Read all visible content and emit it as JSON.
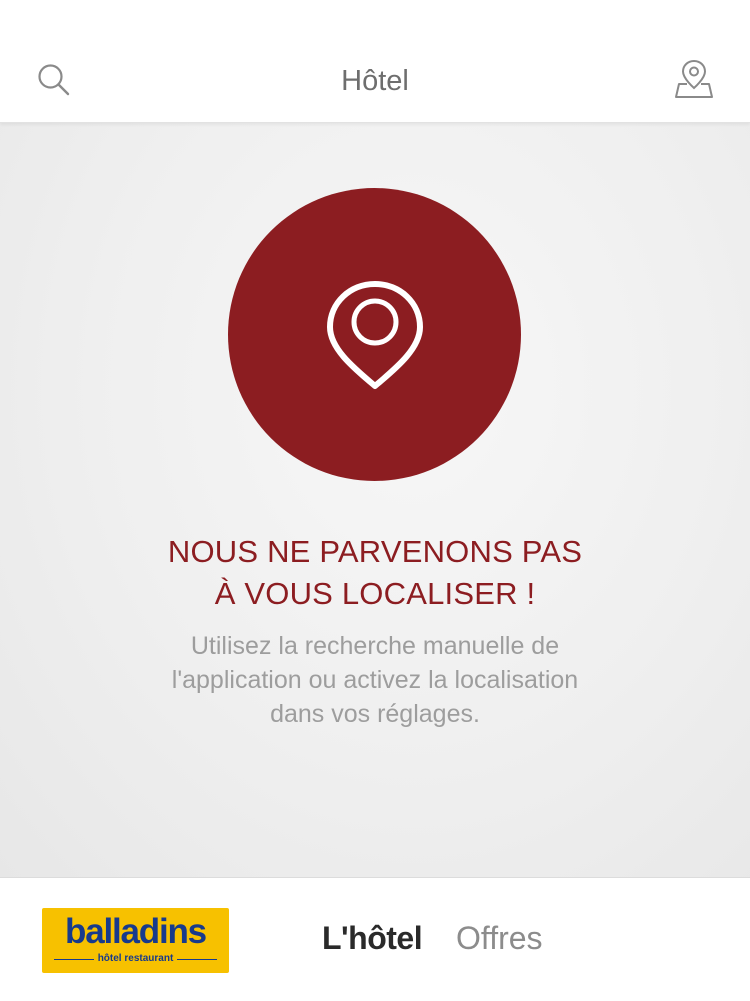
{
  "header": {
    "title": "Hôtel",
    "search_icon": "search-icon",
    "map_icon": "map-pin-icon"
  },
  "error": {
    "icon": "location-pin-icon",
    "title_line1": "NOUS NE PARVENONS PAS",
    "title_line2": "À VOUS LOCALISER !",
    "message_line1": "Utilisez la recherche manuelle de",
    "message_line2": "l'application ou activez la localisation",
    "message_line3": "dans vos réglages."
  },
  "footer": {
    "logo": {
      "brand": "balladins",
      "tagline": "hôtel restaurant"
    },
    "tabs": [
      {
        "label": "L'hôtel",
        "active": true
      },
      {
        "label": "Offres",
        "active": false
      }
    ]
  },
  "colors": {
    "accent": "#8c1d21",
    "logo_yellow": "#f7c100",
    "logo_blue": "#173a8c"
  }
}
